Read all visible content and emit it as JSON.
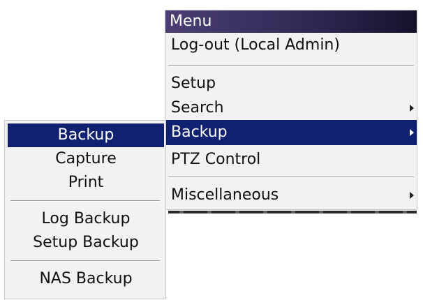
{
  "main_menu": {
    "title": "Menu",
    "items": [
      {
        "label": "Log-out (Local Admin)"
      },
      {
        "label": "Setup"
      },
      {
        "label": "Search"
      },
      {
        "label": "Backup"
      },
      {
        "label": "PTZ Control"
      },
      {
        "label": "Miscellaneous"
      }
    ],
    "selected": "Backup",
    "submenu_arrow_icon": "triangle-right-icon"
  },
  "sub_menu": {
    "items": [
      {
        "label": "Backup"
      },
      {
        "label": "Capture"
      },
      {
        "label": "Print"
      },
      {
        "label": "Log Backup"
      },
      {
        "label": "Setup Backup"
      },
      {
        "label": "NAS Backup"
      }
    ],
    "selected": "Backup"
  },
  "colors": {
    "title_bar": "#2e2752",
    "selection": "#0f2170",
    "menu_background": "#f2f2f2",
    "text": "#101010"
  }
}
